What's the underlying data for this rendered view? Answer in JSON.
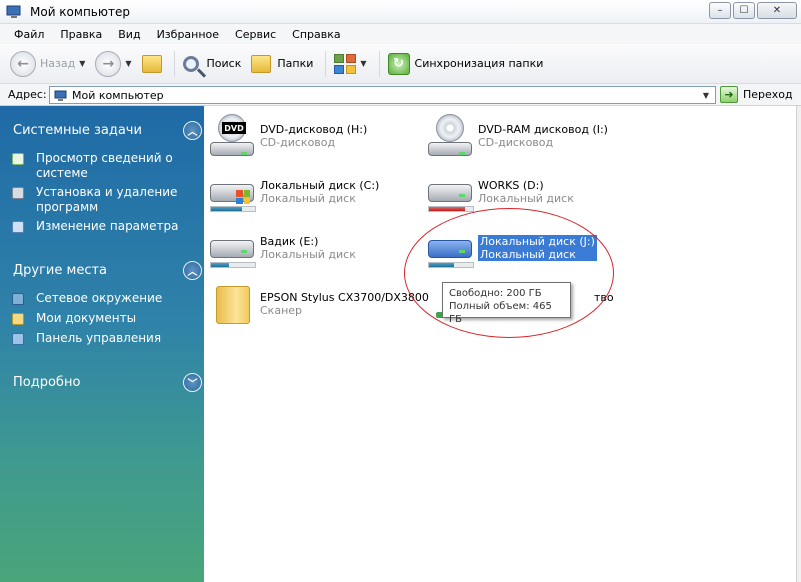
{
  "window": {
    "title": "Мой компьютер"
  },
  "menu": [
    "Файл",
    "Правка",
    "Вид",
    "Избранное",
    "Сервис",
    "Справка"
  ],
  "toolbar": {
    "back_label": "Назад",
    "search_label": "Поиск",
    "folders_label": "Папки",
    "sync_label": "Синхронизация папки"
  },
  "address": {
    "label": "Адрес:",
    "value": "Мой компьютер",
    "go_label": "Переход"
  },
  "sidebar": {
    "system_tasks": {
      "title": "Системные задачи",
      "items": [
        "Просмотр сведений о системе",
        "Установка и удаление программ",
        "Изменение параметра"
      ]
    },
    "other_places": {
      "title": "Другие места",
      "items": [
        "Сетевое окружение",
        "Мои документы",
        "Панель управления"
      ]
    },
    "details": {
      "title": "Подробно"
    }
  },
  "items": [
    {
      "name": "DVD-дисковод (H:)",
      "sub": "CD-дисковод"
    },
    {
      "name": "DVD-RAM дисковод (I:)",
      "sub": "CD-дисковод"
    },
    {
      "name": "Локальный диск (C:)",
      "sub": "Локальный диск",
      "usage": 0.7
    },
    {
      "name": "WORKS (D:)",
      "sub": "Локальный диск",
      "usage": 0.82
    },
    {
      "name": "Вадик (E:)",
      "sub": "Локальный диск",
      "usage": 0.42
    },
    {
      "name": "Локальный диск (J:)",
      "sub": "Локальный диск",
      "usage": 0.57
    },
    {
      "name": "EPSON Stylus CX3700/DX3800",
      "sub": "Сканер"
    },
    {
      "name": "тво"
    }
  ],
  "tooltip": {
    "line1": "Свободно: 200 ГБ",
    "line2": "Полный объем: 465 ГБ"
  },
  "colors": {
    "accent": "#3a7bd5",
    "annotation": "#d8242a"
  }
}
